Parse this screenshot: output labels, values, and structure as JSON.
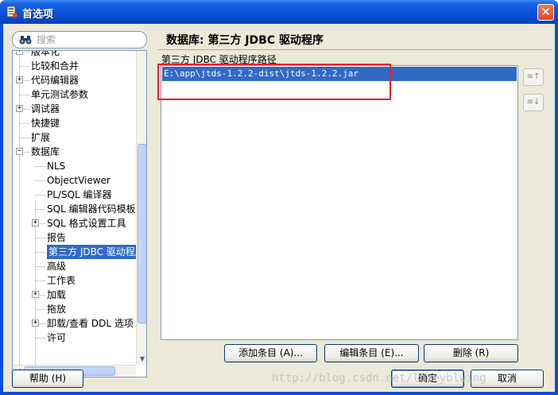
{
  "window": {
    "title": "首选项",
    "close_symbol": "✕"
  },
  "search": {
    "placeholder": "搜索"
  },
  "tree": {
    "items": [
      {
        "label": "版本化",
        "level": 1,
        "expandable": true
      },
      {
        "label": "比较和合并",
        "level": 1,
        "expandable": false
      },
      {
        "label": "代码编辑器",
        "level": 1,
        "expandable": true
      },
      {
        "label": "单元测试参数",
        "level": 1,
        "expandable": false
      },
      {
        "label": "调试器",
        "level": 1,
        "expandable": true
      },
      {
        "label": "快捷键",
        "level": 1,
        "expandable": false
      },
      {
        "label": "扩展",
        "level": 1,
        "expandable": false
      },
      {
        "label": "数据库",
        "level": 1,
        "expandable": true,
        "expanded": true
      },
      {
        "label": "NLS",
        "level": 2,
        "expandable": false
      },
      {
        "label": "ObjectViewer",
        "level": 2,
        "expandable": false
      },
      {
        "label": "PL/SQL 编译器",
        "level": 2,
        "expandable": false
      },
      {
        "label": "SQL 编辑器代码模板",
        "level": 2,
        "expandable": false
      },
      {
        "label": "SQL 格式设置工具",
        "level": 2,
        "expandable": true
      },
      {
        "label": "报告",
        "level": 2,
        "expandable": false
      },
      {
        "label": "第三方 JDBC 驱动程序",
        "level": 2,
        "expandable": false,
        "selected": true
      },
      {
        "label": "高级",
        "level": 2,
        "expandable": false
      },
      {
        "label": "工作表",
        "level": 2,
        "expandable": false
      },
      {
        "label": "加载",
        "level": 2,
        "expandable": true
      },
      {
        "label": "拖放",
        "level": 2,
        "expandable": false
      },
      {
        "label": "卸载/查看 DDL 选项",
        "level": 2,
        "expandable": true
      },
      {
        "label": "许可",
        "level": 2,
        "expandable": false
      }
    ]
  },
  "pane": {
    "title": "数据库: 第三方 JDBC 驱动程序",
    "path_label": "第三方 JDBC 驱动程序路径",
    "paths": [
      "E:\\app\\jtds-1.2.2-dist\\jtds-1.2.2.jar"
    ]
  },
  "buttons": {
    "add": "添加条目 (A)...",
    "edit": "编辑条目 (E)...",
    "delete": "删除 (R)",
    "help": "帮助 (H)",
    "ok": "确定",
    "cancel": "取消",
    "move_up": "≡↑",
    "move_down": "≡↓"
  },
  "watermark": "http://blog.csdn.net/loveyblwing",
  "colors": {
    "selection": "#316ac5",
    "highlight_border": "#e8202a",
    "titlebar": "#0b52da"
  }
}
